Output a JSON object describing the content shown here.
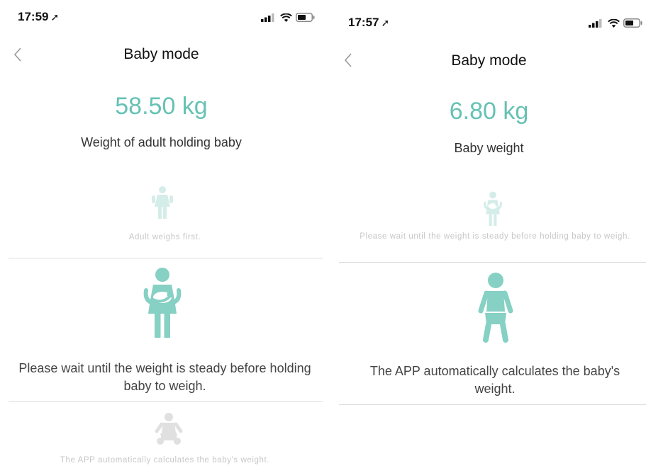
{
  "colors": {
    "accent": "#66c2b4",
    "faded_icon": "#d5ede9",
    "faded_gray": "#e0e0e0",
    "active_icon": "#86d0c4"
  },
  "screen1": {
    "status": {
      "time": "17:59",
      "location_icon": "location-arrow-icon",
      "signal_icon": "cellular-signal-icon",
      "wifi_icon": "wifi-icon",
      "battery_icon": "battery-icon"
    },
    "nav": {
      "title": "Baby mode",
      "back_icon": "chevron-left-icon"
    },
    "weight_value": "58.50 kg",
    "weight_label": "Weight of adult holding baby",
    "steps": [
      {
        "text": "Adult weighs first.",
        "icon": "adult-icon",
        "state": "faded"
      },
      {
        "text": "Please wait until the weight is steady before holding baby to weigh.",
        "icon": "adult-holding-baby-icon",
        "state": "active"
      },
      {
        "text": "The APP automatically calculates the baby's weight.",
        "icon": "baby-icon",
        "state": "faded"
      }
    ]
  },
  "screen2": {
    "status": {
      "time": "17:57",
      "location_icon": "location-arrow-icon",
      "signal_icon": "cellular-signal-icon",
      "wifi_icon": "wifi-icon",
      "battery_icon": "battery-icon"
    },
    "nav": {
      "title": "Baby mode",
      "back_icon": "chevron-left-icon"
    },
    "weight_value": "6.80 kg",
    "weight_label": "Baby weight",
    "steps": [
      {
        "text": "Please wait until the weight is steady before holding baby to weigh.",
        "icon": "adult-holding-baby-icon",
        "state": "faded"
      },
      {
        "text": "The APP automatically calculates the baby's weight.",
        "icon": "baby-icon",
        "state": "active"
      }
    ]
  }
}
